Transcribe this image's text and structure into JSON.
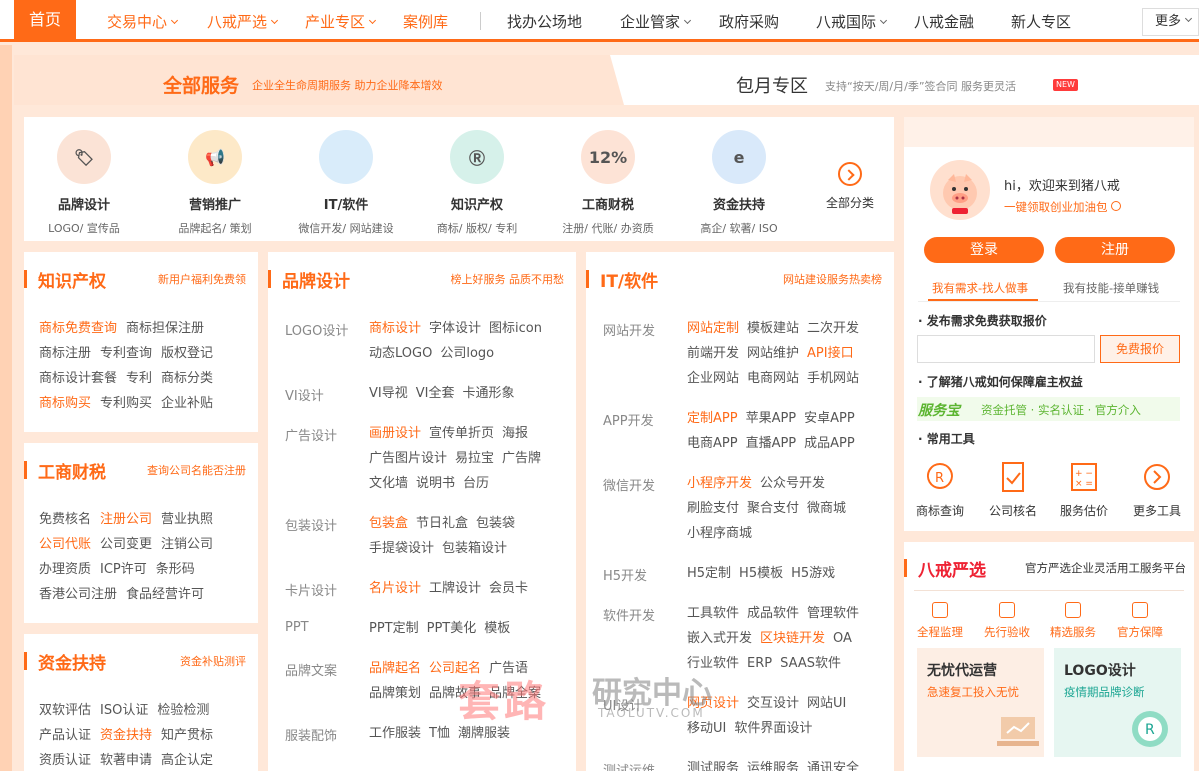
{
  "nav": {
    "home": "首页",
    "items": [
      {
        "label": "交易中心",
        "chev": true,
        "orange": true
      },
      {
        "label": "八戒严选",
        "chev": true,
        "orange": true
      },
      {
        "label": "产业专区",
        "chev": true,
        "orange": true
      },
      {
        "label": "案例库",
        "chev": false,
        "orange": true
      },
      {
        "label": "找办公场地",
        "chev": false,
        "orange": false
      },
      {
        "label": "企业管家",
        "chev": true,
        "orange": false
      },
      {
        "label": "政府采购",
        "chev": false,
        "orange": false
      },
      {
        "label": "八戒国际",
        "chev": true,
        "orange": false
      },
      {
        "label": "八戒金融",
        "chev": false,
        "orange": false
      },
      {
        "label": "新人专区",
        "chev": false,
        "orange": false
      }
    ],
    "more": "更多"
  },
  "band": {
    "title": "全部服务",
    "subtitle": "企业全生命周期服务 助力企业降本增效",
    "title2": "包月专区",
    "subtitle2": "支持“按天/周/月/季”签合同 服务更灵活",
    "new_badge": "NEW"
  },
  "categories": [
    {
      "title": "品牌设计",
      "sub": "LOGO/ 宣传品",
      "icon": "brand-icon",
      "color": "#fbe3d6"
    },
    {
      "title": "营销推广",
      "sub": "品牌起名/ 策划",
      "icon": "megaphone-icon",
      "color": "#fde9c8"
    },
    {
      "title": "IT/软件",
      "sub": "微信开发/ 网站建设",
      "icon": "monitor-icon",
      "color": "#d9ecfa"
    },
    {
      "title": "知识产权",
      "sub": "商标/ 版权/ 专利",
      "icon": "trademark-icon",
      "color": "#d6f1ea"
    },
    {
      "title": "工商财税",
      "sub": "注册/ 代账/ 办资质",
      "icon": "calculator-icon",
      "color": "#fde3d6"
    },
    {
      "title": "资金扶持",
      "sub": "高企/ 软著/ ISO",
      "icon": "chip-icon",
      "color": "#d9e9fa"
    }
  ],
  "all_categories": "全部分类",
  "ip": {
    "title": "知识产权",
    "sub": "新用户福利免费领",
    "rows": [
      [
        {
          "t": "商标免费查询",
          "h": true
        },
        {
          "t": "商标担保注册",
          "h": false
        }
      ],
      [
        {
          "t": "商标注册",
          "h": false
        },
        {
          "t": "专利查询",
          "h": false
        },
        {
          "t": "版权登记",
          "h": false
        }
      ],
      [
        {
          "t": "商标设计套餐",
          "h": false
        },
        {
          "t": "专利",
          "h": false
        },
        {
          "t": "商标分类",
          "h": false
        }
      ],
      [
        {
          "t": "商标购买",
          "h": true
        },
        {
          "t": "专利购买",
          "h": false
        },
        {
          "t": "企业补贴",
          "h": false
        }
      ]
    ]
  },
  "biz": {
    "title": "工商财税",
    "sub": "查询公司名能否注册",
    "rows": [
      [
        {
          "t": "免费核名",
          "h": false
        },
        {
          "t": "注册公司",
          "h": true
        },
        {
          "t": "营业执照",
          "h": false
        }
      ],
      [
        {
          "t": "公司代账",
          "h": true
        },
        {
          "t": "公司变更",
          "h": false
        },
        {
          "t": "注销公司",
          "h": false
        }
      ],
      [
        {
          "t": "办理资质",
          "h": false
        },
        {
          "t": "ICP许可",
          "h": false
        },
        {
          "t": "条形码",
          "h": false
        }
      ],
      [
        {
          "t": "香港公司注册",
          "h": false
        },
        {
          "t": "食品经营许可",
          "h": false
        }
      ]
    ]
  },
  "fund": {
    "title": "资金扶持",
    "sub": "资金补贴测评",
    "rows": [
      [
        {
          "t": "双软评估",
          "h": false
        },
        {
          "t": "ISO认证",
          "h": false
        },
        {
          "t": "检验检测",
          "h": false
        }
      ],
      [
        {
          "t": "产品认证",
          "h": false
        },
        {
          "t": "资金扶持",
          "h": true
        },
        {
          "t": "知产贯标",
          "h": false
        }
      ],
      [
        {
          "t": "资质认证",
          "h": false
        },
        {
          "t": "软著申请",
          "h": false
        },
        {
          "t": "高企认定",
          "h": false
        }
      ]
    ]
  },
  "brand": {
    "title": "品牌设计",
    "sub": "榜上好服务 品质不用愁",
    "groups": [
      {
        "label": "LOGO设计",
        "items": [
          {
            "t": "商标设计",
            "h": true
          },
          {
            "t": "字体设计",
            "h": false
          },
          {
            "t": "图标icon",
            "h": false
          },
          {
            "t": "动态LOGO",
            "h": false
          },
          {
            "t": "公司logo",
            "h": false
          }
        ]
      },
      {
        "label": "VI设计",
        "items": [
          {
            "t": "VI导视",
            "h": false
          },
          {
            "t": "VI全套",
            "h": false
          },
          {
            "t": "卡通形象",
            "h": false
          }
        ]
      },
      {
        "label": "广告设计",
        "items": [
          {
            "t": "画册设计",
            "h": true
          },
          {
            "t": "宣传单折页",
            "h": false
          },
          {
            "t": "海报",
            "h": false
          },
          {
            "t": "广告图片设计",
            "h": false
          },
          {
            "t": "易拉宝",
            "h": false
          },
          {
            "t": "广告牌",
            "h": false
          },
          {
            "t": "文化墙",
            "h": false
          },
          {
            "t": "说明书",
            "h": false
          },
          {
            "t": "台历",
            "h": false
          }
        ]
      },
      {
        "label": "包装设计",
        "items": [
          {
            "t": "包装盒",
            "h": true
          },
          {
            "t": "节日礼盒",
            "h": false
          },
          {
            "t": "包装袋",
            "h": false
          },
          {
            "t": "手提袋设计",
            "h": false
          },
          {
            "t": "包装箱设计",
            "h": false
          }
        ]
      },
      {
        "label": "卡片设计",
        "items": [
          {
            "t": "名片设计",
            "h": true
          },
          {
            "t": "工牌设计",
            "h": false
          },
          {
            "t": "会员卡",
            "h": false
          }
        ]
      },
      {
        "label": "PPT",
        "items": [
          {
            "t": "PPT定制",
            "h": false
          },
          {
            "t": "PPT美化",
            "h": false
          },
          {
            "t": "模板",
            "h": false
          }
        ]
      },
      {
        "label": "品牌文案",
        "items": [
          {
            "t": "品牌起名",
            "h": true
          },
          {
            "t": "公司起名",
            "h": true
          },
          {
            "t": "广告语",
            "h": false
          },
          {
            "t": "品牌策划",
            "h": false
          },
          {
            "t": "品牌故事",
            "h": false
          },
          {
            "t": "品牌全案",
            "h": false
          }
        ]
      },
      {
        "label": "服装配饰",
        "items": [
          {
            "t": "工作服装",
            "h": false
          },
          {
            "t": "T恤",
            "h": false
          },
          {
            "t": "潮牌服装",
            "h": false
          }
        ]
      }
    ]
  },
  "it": {
    "title": "IT/软件",
    "sub": "网站建设服务热卖榜",
    "groups": [
      {
        "label": "网站开发",
        "items": [
          {
            "t": "网站定制",
            "h": true
          },
          {
            "t": "模板建站",
            "h": false
          },
          {
            "t": "二次开发",
            "h": false
          },
          {
            "t": "前端开发",
            "h": false
          },
          {
            "t": "网站维护",
            "h": false
          },
          {
            "t": "API接口",
            "h": true
          },
          {
            "t": "企业网站",
            "h": false
          },
          {
            "t": "电商网站",
            "h": false
          },
          {
            "t": "手机网站",
            "h": false
          }
        ]
      },
      {
        "label": "APP开发",
        "items": [
          {
            "t": "定制APP",
            "h": true
          },
          {
            "t": "苹果APP",
            "h": false
          },
          {
            "t": "安卓APP",
            "h": false
          },
          {
            "t": "电商APP",
            "h": false
          },
          {
            "t": "直播APP",
            "h": false
          },
          {
            "t": "成品APP",
            "h": false
          }
        ]
      },
      {
        "label": "微信开发",
        "items": [
          {
            "t": "小程序开发",
            "h": true
          },
          {
            "t": "公众号开发",
            "h": false
          },
          {
            "t": "刷脸支付",
            "h": false
          },
          {
            "t": "聚合支付",
            "h": false
          },
          {
            "t": "微商城",
            "h": false
          },
          {
            "t": "小程序商城",
            "h": false
          }
        ]
      },
      {
        "label": "H5开发",
        "items": [
          {
            "t": "H5定制",
            "h": false
          },
          {
            "t": "H5模板",
            "h": false
          },
          {
            "t": "H5游戏",
            "h": false
          }
        ]
      },
      {
        "label": "软件开发",
        "items": [
          {
            "t": "工具软件",
            "h": false
          },
          {
            "t": "成品软件",
            "h": false
          },
          {
            "t": "管理软件",
            "h": false
          },
          {
            "t": "嵌入式开发",
            "h": false
          },
          {
            "t": "区块链开发",
            "h": true
          },
          {
            "t": "OA",
            "h": false
          },
          {
            "t": "行业软件",
            "h": false
          },
          {
            "t": "ERP",
            "h": false
          },
          {
            "t": "SAAS软件",
            "h": false
          }
        ]
      },
      {
        "label": "UI设计",
        "items": [
          {
            "t": "网页设计",
            "h": true
          },
          {
            "t": "交互设计",
            "h": false
          },
          {
            "t": "网站UI",
            "h": false
          },
          {
            "t": "移动UI",
            "h": false
          },
          {
            "t": "软件界面设计",
            "h": false
          }
        ]
      },
      {
        "label": "测试运维",
        "items": [
          {
            "t": "测试服务",
            "h": false
          },
          {
            "t": "运维服务",
            "h": false
          },
          {
            "t": "通讯安全",
            "h": false
          }
        ]
      }
    ]
  },
  "user": {
    "greeting": "hi，欢迎来到猪八戒",
    "link": "一键领取创业加油包",
    "login": "登录",
    "register": "注册",
    "tab1": "我有需求-找人做事",
    "tab2": "我有技能-接单赚钱",
    "publish": "发布需求免费获取报价",
    "input_placeholder": "",
    "quote": "免费报价",
    "guarantee": "了解猪八戒如何保障雇主权益",
    "fwb": "服务宝",
    "fwb_items": "资金托管 · 实名认证 · 官方介入",
    "tools_title": "常用工具",
    "tools": [
      "商标查询",
      "公司核名",
      "服务估价",
      "更多工具"
    ]
  },
  "yanxuan": {
    "title": "八戒严选",
    "sub": "官方严选企业灵活用工服务平台",
    "features": [
      "全程监理",
      "先行验收",
      "精选服务",
      "官方保障"
    ],
    "promo1_title": "无忧代运营",
    "promo1_sub": "急速复工投入无忧",
    "promo2_title": "LOGO设计",
    "promo2_sub": "疫情期品牌诊断"
  },
  "watermark": {
    "a": "套路",
    "b": "研究中心",
    "c": "TAOLUTV.COM"
  }
}
